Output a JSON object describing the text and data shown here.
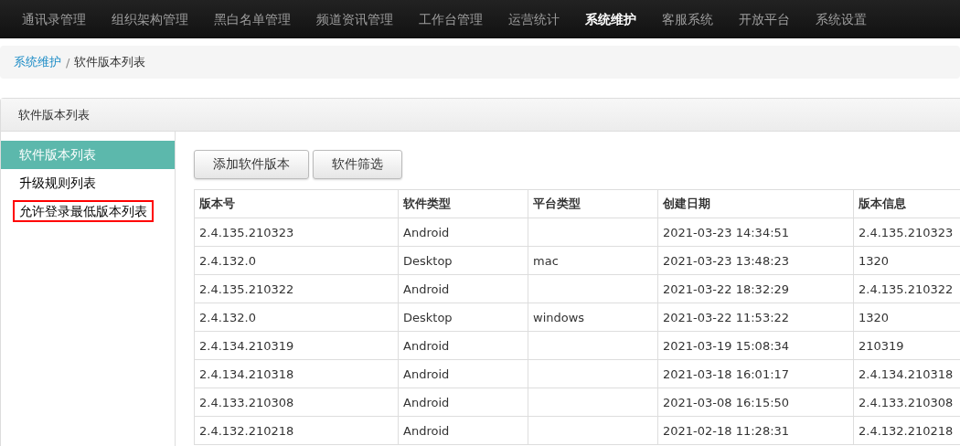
{
  "nav": [
    {
      "label": "通讯录管理",
      "selected": false
    },
    {
      "label": "组织架构管理",
      "selected": false
    },
    {
      "label": "黑白名单管理",
      "selected": false
    },
    {
      "label": "频道资讯管理",
      "selected": false
    },
    {
      "label": "工作台管理",
      "selected": false
    },
    {
      "label": "运营统计",
      "selected": false
    },
    {
      "label": "系统维护",
      "selected": true
    },
    {
      "label": "客服系统",
      "selected": false
    },
    {
      "label": "开放平台",
      "selected": false
    },
    {
      "label": "系统设置",
      "selected": false
    }
  ],
  "breadcrumb": {
    "link": "系统维护",
    "separator": "/",
    "current": "软件版本列表"
  },
  "panel": {
    "title": "软件版本列表"
  },
  "sidebar": {
    "items": [
      {
        "label": "软件版本列表",
        "selected": true,
        "highlighted": false
      },
      {
        "label": "升级规则列表",
        "selected": false,
        "highlighted": false
      },
      {
        "label": "允许登录最低版本列表",
        "selected": false,
        "highlighted": true
      }
    ]
  },
  "buttons": [
    "添加软件版本",
    "软件筛选"
  ],
  "table": {
    "columns": [
      "版本号",
      "软件类型",
      "平台类型",
      "创建日期",
      "版本信息"
    ],
    "rows": [
      {
        "version": "2.4.135.210323",
        "software_type": "Android",
        "created": "2021-03-23 14:34:51",
        "info": "2.4.135.210323"
      },
      {
        "version": "2.4.132.0",
        "software_type": "Desktop",
        "platform": "mac",
        "created": "2021-03-23 13:48:23",
        "info": "1320"
      },
      {
        "version": "2.4.135.210322",
        "software_type": "Android",
        "created": "2021-03-22 18:32:29",
        "info": "2.4.135.210322"
      },
      {
        "version": "2.4.132.0",
        "software_type": "Desktop",
        "platform": "windows",
        "created": "2021-03-22 11:53:22",
        "info": "1320"
      },
      {
        "version": "2.4.134.210319",
        "software_type": "Android",
        "created": "2021-03-19 15:08:34",
        "info": "210319"
      },
      {
        "version": "2.4.134.210318",
        "software_type": "Android",
        "created": "2021-03-18 16:01:17",
        "info": "2.4.134.210318"
      },
      {
        "version": "2.4.133.210308",
        "software_type": "Android",
        "created": "2021-03-08 16:15:50",
        "info": "2.4.133.210308"
      },
      {
        "version": "2.4.132.210218",
        "software_type": "Android",
        "created": "2021-02-18 11:28:31",
        "info": "2.4.132.210218"
      }
    ]
  }
}
